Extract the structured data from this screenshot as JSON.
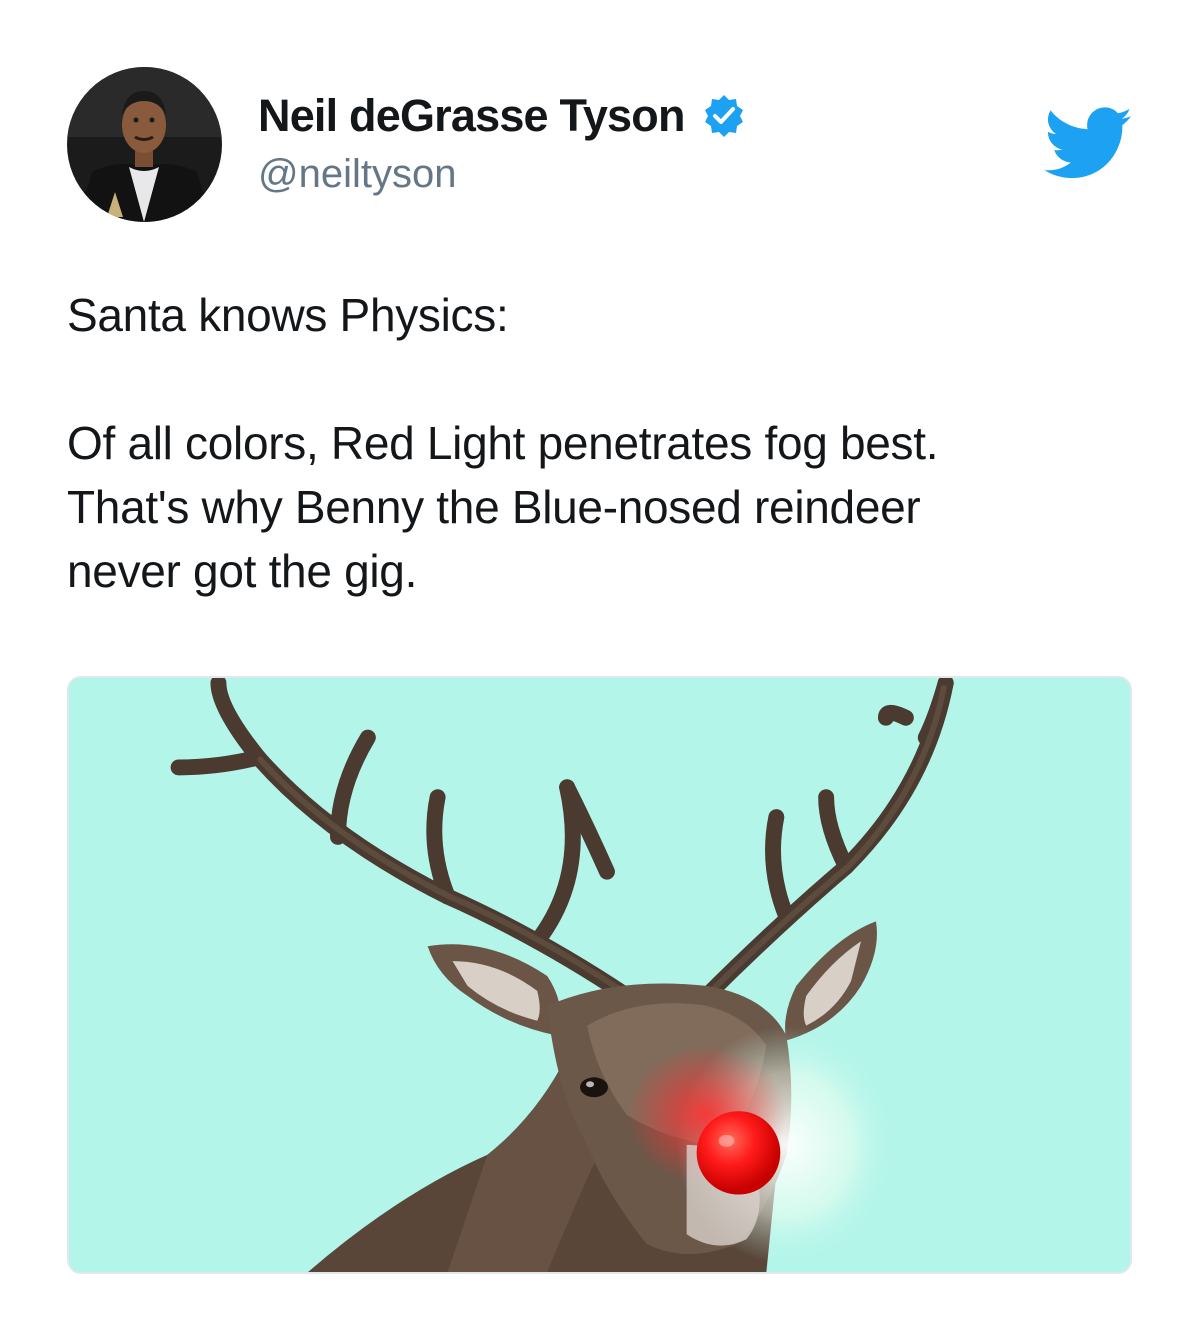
{
  "tweet": {
    "author": {
      "display_name": "Neil deGrasse Tyson",
      "handle": "@neiltyson",
      "verified": true,
      "avatar_icon": "avatar-photo"
    },
    "brand_icon": "twitter-bird-icon",
    "text_lines": [
      "Santa knows Physics:",
      "Of all colors, Red Light penetrates fog best.",
      "That's why Benny the Blue-nosed reindeer",
      "never got the gig."
    ],
    "media": {
      "kind": "image",
      "subject": "reindeer-with-red-nose"
    }
  },
  "colors": {
    "brand_blue": "#1da1f2",
    "handle_gray": "#657786",
    "text_dark": "#14171a",
    "media_background": "#b4f5ea",
    "nose_red": "#ff1a1a"
  }
}
